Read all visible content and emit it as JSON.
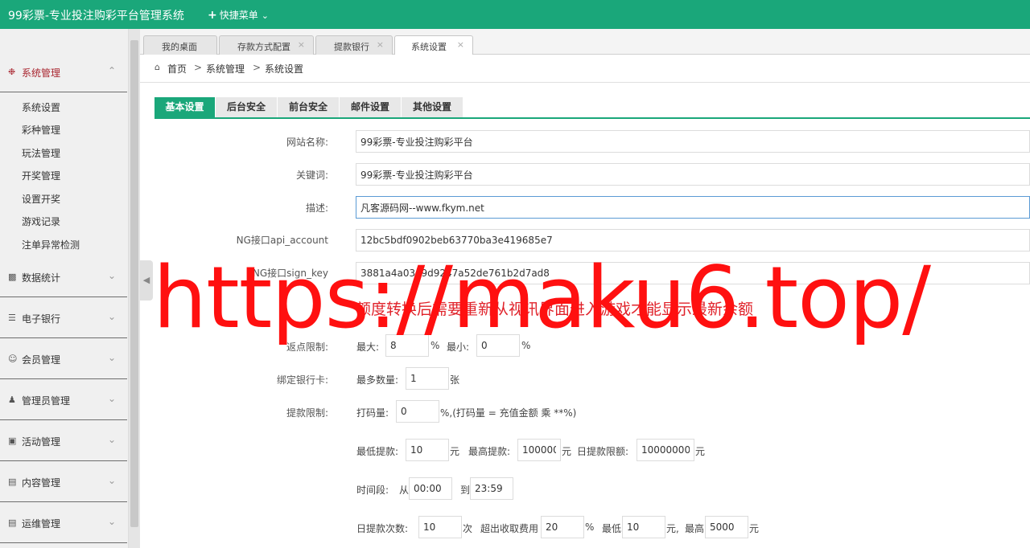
{
  "app": {
    "title": "99彩票-专业投注购彩平台管理系统",
    "quick_menu": "快捷菜单"
  },
  "sidebar": {
    "sections": [
      {
        "label": "系统管理",
        "icon": "gear-icon",
        "expanded": true,
        "items": [
          "系统设置",
          "彩种管理",
          "玩法管理",
          "开奖管理",
          "设置开奖",
          "游戏记录",
          "注单异常检测"
        ]
      },
      {
        "label": "数据统计",
        "icon": "bar-chart-icon"
      },
      {
        "label": "电子银行",
        "icon": "list-icon"
      },
      {
        "label": "会员管理",
        "icon": "user-icon"
      },
      {
        "label": "管理员管理",
        "icon": "admin-icon"
      },
      {
        "label": "活动管理",
        "icon": "gift-icon"
      },
      {
        "label": "内容管理",
        "icon": "book-icon"
      },
      {
        "label": "运维管理",
        "icon": "book-icon"
      }
    ]
  },
  "page_tabs": [
    {
      "label": "我的桌面",
      "closable": false
    },
    {
      "label": "存款方式配置",
      "closable": true
    },
    {
      "label": "提款银行",
      "closable": true
    },
    {
      "label": "系统设置",
      "closable": true,
      "active": true
    }
  ],
  "breadcrumb": [
    "首页",
    "系统管理",
    "系统设置"
  ],
  "breadcrumb_sep": ">",
  "settings_tabs": [
    "基本设置",
    "后台安全",
    "前台安全",
    "邮件设置",
    "其他设置"
  ],
  "form": {
    "site_name": {
      "label": "网站名称:",
      "value": "99彩票-专业投注购彩平台"
    },
    "keywords": {
      "label": "关键词:",
      "value": "99彩票-专业投注购彩平台"
    },
    "description": {
      "label": "描述:",
      "value": "凡客源码网--www.fkym.net"
    },
    "ng_account": {
      "label": "NG接口api_account",
      "value": "12bc5bdf0902beb63770ba3e419685e7"
    },
    "ng_key": {
      "label": "NG接口sign_key",
      "value": "3881a4a03a9d9247a52de761b2d7ad8"
    },
    "notice": "额度转换后需要重新从视讯界面进入游戏才能显示最新余额",
    "rebate": {
      "label": "返点限制:",
      "max_label": "最大:",
      "max": "8",
      "min_label": "最小:",
      "min": "0",
      "unit": "%"
    },
    "bind_card": {
      "label": "绑定银行卡:",
      "max_label": "最多数量:",
      "max": "1",
      "unit": "张"
    },
    "withdraw": {
      "label": "提款限制:",
      "bet_label": "打码量:",
      "bet": "0",
      "bet_note": "%,(打码量 = 充值金额 乘 **%)",
      "min_label": "最低提款:",
      "min": "10",
      "max_label": "最高提款:",
      "max": "100000",
      "daily_label": "日提款限额:",
      "daily": "10000000",
      "yuan": "元",
      "time_label": "时间段:",
      "from_label": "从",
      "from": "00:00",
      "to_label": "到",
      "to": "23:59",
      "times_label": "日提款次数:",
      "times": "10",
      "times_unit": "次",
      "fee_label": "超出收取费用",
      "fee": "20",
      "fee_unit": "%",
      "fee_min_label": "最低",
      "fee_min": "10",
      "fee_min_unit": "元,",
      "fee_max_label": "最高",
      "fee_max": "5000",
      "fee_max_unit": "元"
    }
  },
  "watermark": "https://maku6.top/",
  "colors": {
    "brand": "#1aa77a",
    "active_menu": "#a8242e",
    "notice": "#e0222a",
    "watermark": "#ff1010"
  }
}
